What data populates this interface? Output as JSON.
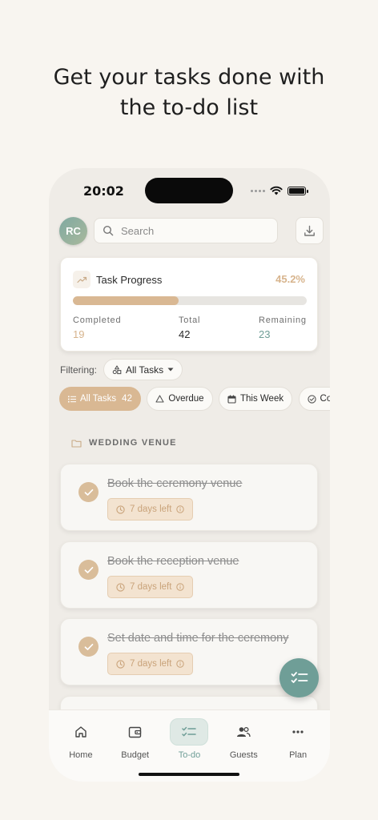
{
  "headline": {
    "line1": "Get your tasks done with",
    "line2": "the to-do list"
  },
  "status_bar": {
    "time": "20:02"
  },
  "header": {
    "avatar_initials": "RC",
    "search_placeholder": "Search"
  },
  "progress": {
    "title": "Task Progress",
    "percent_label": "45.2%",
    "fraction": 0.452,
    "completed_label": "Completed",
    "completed": "19",
    "total_label": "Total",
    "total": "42",
    "remaining_label": "Remaining",
    "remaining": "23"
  },
  "filtering": {
    "label": "Filtering:",
    "selected": "All Tasks"
  },
  "chips": [
    {
      "label": "All Tasks",
      "count": "42",
      "icon": "list-icon"
    },
    {
      "label": "Overdue",
      "icon": "warning-icon"
    },
    {
      "label": "This Week",
      "icon": "calendar-icon"
    },
    {
      "label": "Completed",
      "icon": "check-circle-icon"
    }
  ],
  "section": {
    "title": "WEDDING VENUE"
  },
  "tasks": [
    {
      "title": "Book the ceremony venue",
      "due": "7 days left",
      "done": true
    },
    {
      "title": "Book the reception venue",
      "due": "7 days left",
      "done": true
    },
    {
      "title": "Set date and time for the ceremony",
      "due": "7 days left",
      "done": true
    }
  ],
  "tabs": [
    {
      "label": "Home",
      "icon": "home-icon",
      "active": false
    },
    {
      "label": "Budget",
      "icon": "wallet-icon",
      "active": false
    },
    {
      "label": "To-do",
      "icon": "checklist-icon",
      "active": true
    },
    {
      "label": "Guests",
      "icon": "users-icon",
      "active": false
    },
    {
      "label": "Plan",
      "icon": "more-icon",
      "active": false
    }
  ],
  "colors": {
    "accent_tan": "#d9b893",
    "accent_teal": "#6f9e97",
    "background": "#f8f5f0"
  }
}
